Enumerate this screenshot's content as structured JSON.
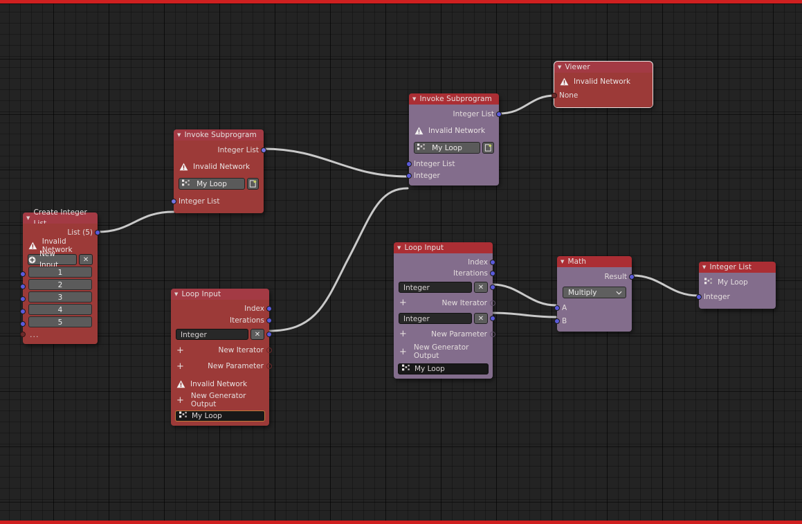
{
  "app": {
    "editor": "blender-node-editor",
    "theme": {
      "background": "#232323",
      "node_header_red": "#a33a44",
      "node_body_red": "#9c3a38",
      "node_header_selected": "#ab2e34",
      "node_body_selected": "#836d8c",
      "noodle": "#c9c9c9",
      "socket_blue": "#5a5ada",
      "accent_bar": "#cf2020",
      "active_outline": "#e8e2e2",
      "highlight_orange": "#c07a3a"
    }
  },
  "nodes": {
    "create_integer_list": {
      "title": "Create Integer List",
      "output_label": "List (5)",
      "warning": "Invalid Network",
      "new_input_label": "New Input",
      "close_label": "✕",
      "values": [
        "1",
        "2",
        "3",
        "4",
        "5"
      ],
      "overflow": "..."
    },
    "invoke_subprogram_1": {
      "title": "Invoke Subprogram",
      "output_label": "Integer List",
      "warning": "Invalid Network",
      "subprogram": "My Loop",
      "input_label": "Integer List"
    },
    "invoke_subprogram_2": {
      "title": "Invoke Subprogram",
      "output_label": "Integer List",
      "warning": "Invalid Network",
      "subprogram": "My Loop",
      "inputs": [
        "Integer List",
        "Integer"
      ]
    },
    "viewer": {
      "title": "Viewer",
      "warning": "Invalid Network",
      "input_label": "None"
    },
    "loop_input_1": {
      "title": "Loop Input",
      "outputs": [
        "Index",
        "Iterations"
      ],
      "iterator_field": "Integer",
      "close_label": "✕",
      "new_iterator": "New Iterator",
      "new_parameter": "New Parameter",
      "warning": "Invalid Network",
      "new_generator_output": "New Generator Output",
      "subprogram": "My Loop"
    },
    "loop_input_2": {
      "title": "Loop Input",
      "outputs": [
        "Index",
        "Iterations"
      ],
      "iterator_field": "Integer",
      "parameter_field": "Integer",
      "close_label": "✕",
      "new_iterator": "New Iterator",
      "new_parameter": "New Parameter",
      "new_generator_output": "New Generator Output",
      "subprogram": "My Loop"
    },
    "math": {
      "title": "Math",
      "output_label": "Result",
      "operation": "Multiply",
      "inputs": [
        "A",
        "B"
      ]
    },
    "integer_list_out": {
      "title": "Integer List",
      "subprogram": "My Loop",
      "input_label": "Integer"
    }
  }
}
